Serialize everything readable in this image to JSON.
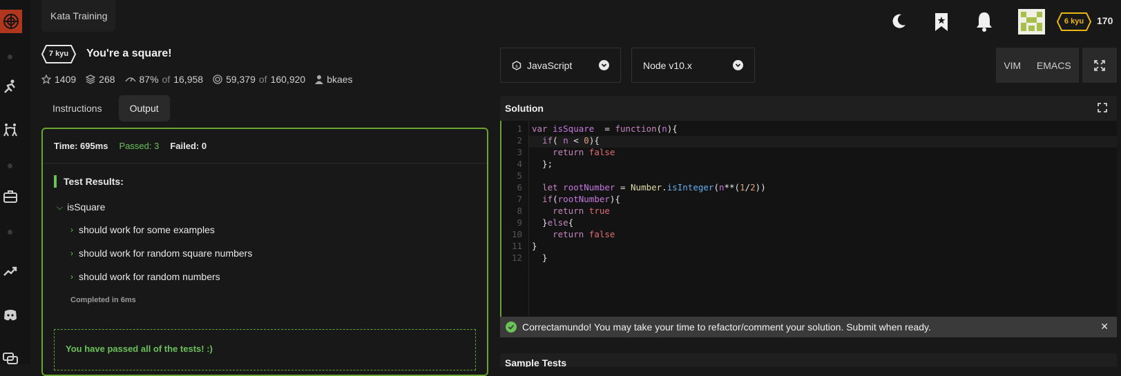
{
  "header": {
    "section_label": "Kata Training",
    "honor": "170",
    "user_rank": "6 kyu"
  },
  "kata": {
    "rank": "7 kyu",
    "title": "You're a square!",
    "stars": "1409",
    "collections": "268",
    "satisfaction": "87%",
    "satisfaction_of": "of",
    "votes": "16,958",
    "completions": "59,379",
    "completions_of": "of",
    "attempts": "160,920",
    "author": "bkaes"
  },
  "tabs": [
    {
      "label": "Instructions"
    },
    {
      "label": "Output"
    }
  ],
  "output": {
    "time": "Time: 695ms",
    "passed": "Passed: 3",
    "failed": "Failed: 0",
    "results_title": "Test Results:",
    "suite": "isSquare",
    "tests": [
      "should work for some examples",
      "should work for random square numbers",
      "should work for random numbers"
    ],
    "completed": "Completed in 6ms",
    "passed_message": "You have passed all of the tests! :)"
  },
  "editor": {
    "language": "JavaScript",
    "version": "Node v10.x",
    "mode_vim": "VIM",
    "mode_emacs": "EMACS",
    "panel_title": "Solution",
    "line_numbers": [
      "1",
      "2",
      "3",
      "4",
      "5",
      "6",
      "7",
      "8",
      "9",
      "10",
      "11",
      "12"
    ]
  },
  "toast": {
    "message": "Correctamundo! You may take your time to refactor/comment your solution. Submit when ready."
  },
  "sample": {
    "title": "Sample Tests"
  },
  "colors": {
    "accent_green": "#6ac259",
    "logo_red": "#b1361e",
    "rank_yellow": "#ecb613"
  }
}
